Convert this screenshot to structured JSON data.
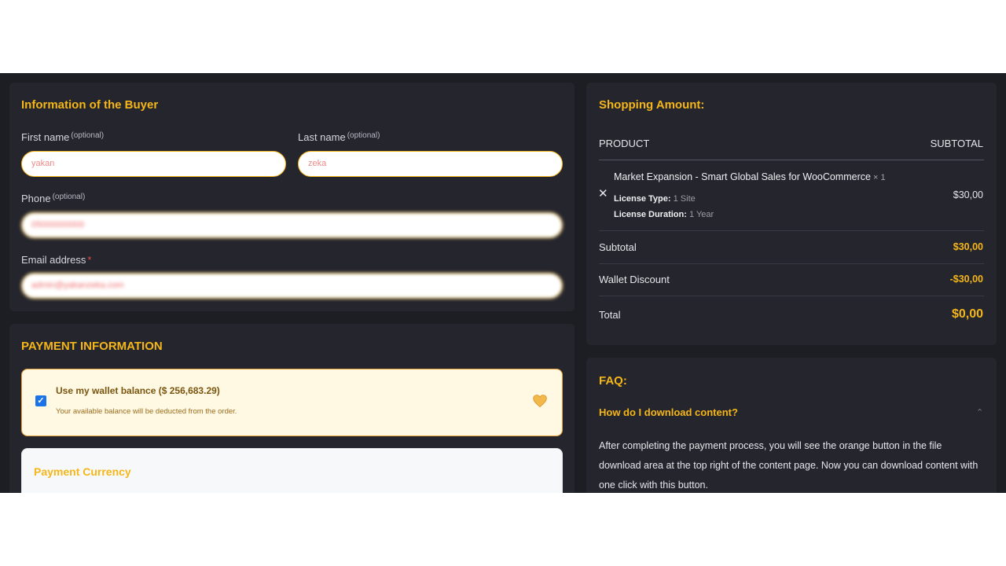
{
  "buyer": {
    "title": "Information of the Buyer",
    "first_name_label": "First name",
    "last_name_label": "Last name",
    "phone_label": "Phone",
    "email_label": "Email address",
    "optional": "(optional)",
    "required_mark": "*",
    "first_name_value": "yakan",
    "last_name_value": "zeka",
    "phone_value": "05000000000",
    "email_value": "admin@yakanzeka.com"
  },
  "payment": {
    "title": "PAYMENT INFORMATION",
    "wallet_label": "Use my wallet balance ($ 256,683.29)",
    "wallet_sub": "Your available balance will be deducted from the order.",
    "wallet_checked": true,
    "currency_title": "Payment Currency"
  },
  "shopping": {
    "title": "Shopping Amount:",
    "col_product": "PRODUCT",
    "col_subtotal": "SUBTOTAL",
    "product_name": "Market Expansion - Smart Global Sales for WooCommerce",
    "product_qty": "× 1",
    "license_type_label": "License Type:",
    "license_type_value": "1 Site",
    "license_duration_label": "License Duration:",
    "license_duration_value": "1 Year",
    "product_price": "$30,00",
    "subtotal_label": "Subtotal",
    "subtotal_value": "$30,00",
    "wallet_discount_label": "Wallet Discount",
    "wallet_discount_value": "-$30,00",
    "total_label": "Total",
    "total_value": "$0,00"
  },
  "faq": {
    "title": "FAQ:",
    "question": "How do I download content?",
    "answer": "After completing the payment process, you will see the orange button in the file download area at the top right of the content page. Now you can download content with one click with this button."
  },
  "colors": {
    "accent": "#f5b619",
    "background": "#1d1d24",
    "card": "#25252e"
  }
}
